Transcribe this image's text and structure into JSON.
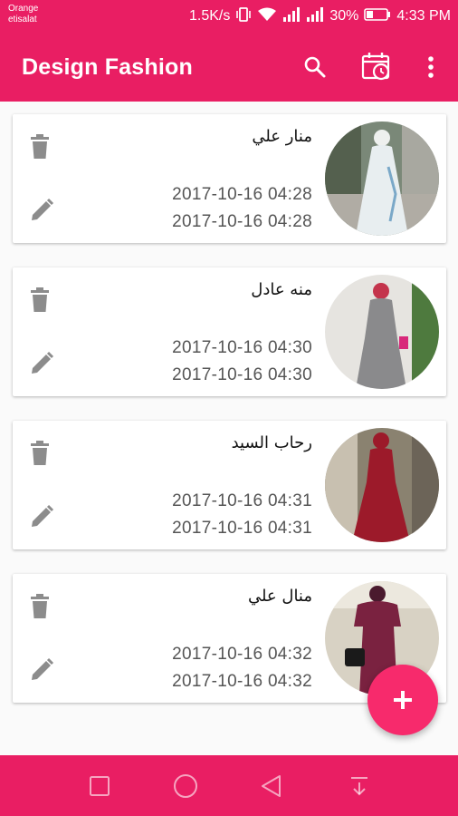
{
  "status_bar": {
    "carrier_line1": "Orange",
    "carrier_line2": "etisalat",
    "speed": "1.5K/s",
    "battery": "30%",
    "time": "4:33 PM",
    "icons": [
      "vibrate-icon",
      "wifi-icon",
      "signal-icon",
      "signal-icon",
      "battery-icon"
    ]
  },
  "app_bar": {
    "title": "Design Fashion",
    "actions": [
      "search-icon",
      "calendar-clock-icon",
      "more-vert-icon"
    ]
  },
  "items": [
    {
      "name": "منار علي",
      "date_line1": "2017-10-16  04:28",
      "date_line2": "2017-10-16  04:28",
      "dress_color": "#e8eef0"
    },
    {
      "name": "منه عادل",
      "date_line1": "2017-10-16  04:30",
      "date_line2": "2017-10-16  04:30",
      "dress_color": "#8a8a8c"
    },
    {
      "name": "رحاب السيد",
      "date_line1": "2017-10-16  04:31",
      "date_line2": "2017-10-16  04:31",
      "dress_color": "#9c1a2a"
    },
    {
      "name": "منال علي",
      "date_line1": "2017-10-16  04:32",
      "date_line2": "2017-10-16  04:32",
      "dress_color": "#7a2240"
    }
  ],
  "fab": {
    "icon": "plus-icon"
  },
  "nav_bar": {
    "icons": [
      "square-icon",
      "circle-icon",
      "triangle-back-icon",
      "notification-drawer-icon"
    ]
  },
  "colors": {
    "primary": "#e91e63",
    "accent": "#f72a6c",
    "icon_gray": "#8c8c8c"
  }
}
